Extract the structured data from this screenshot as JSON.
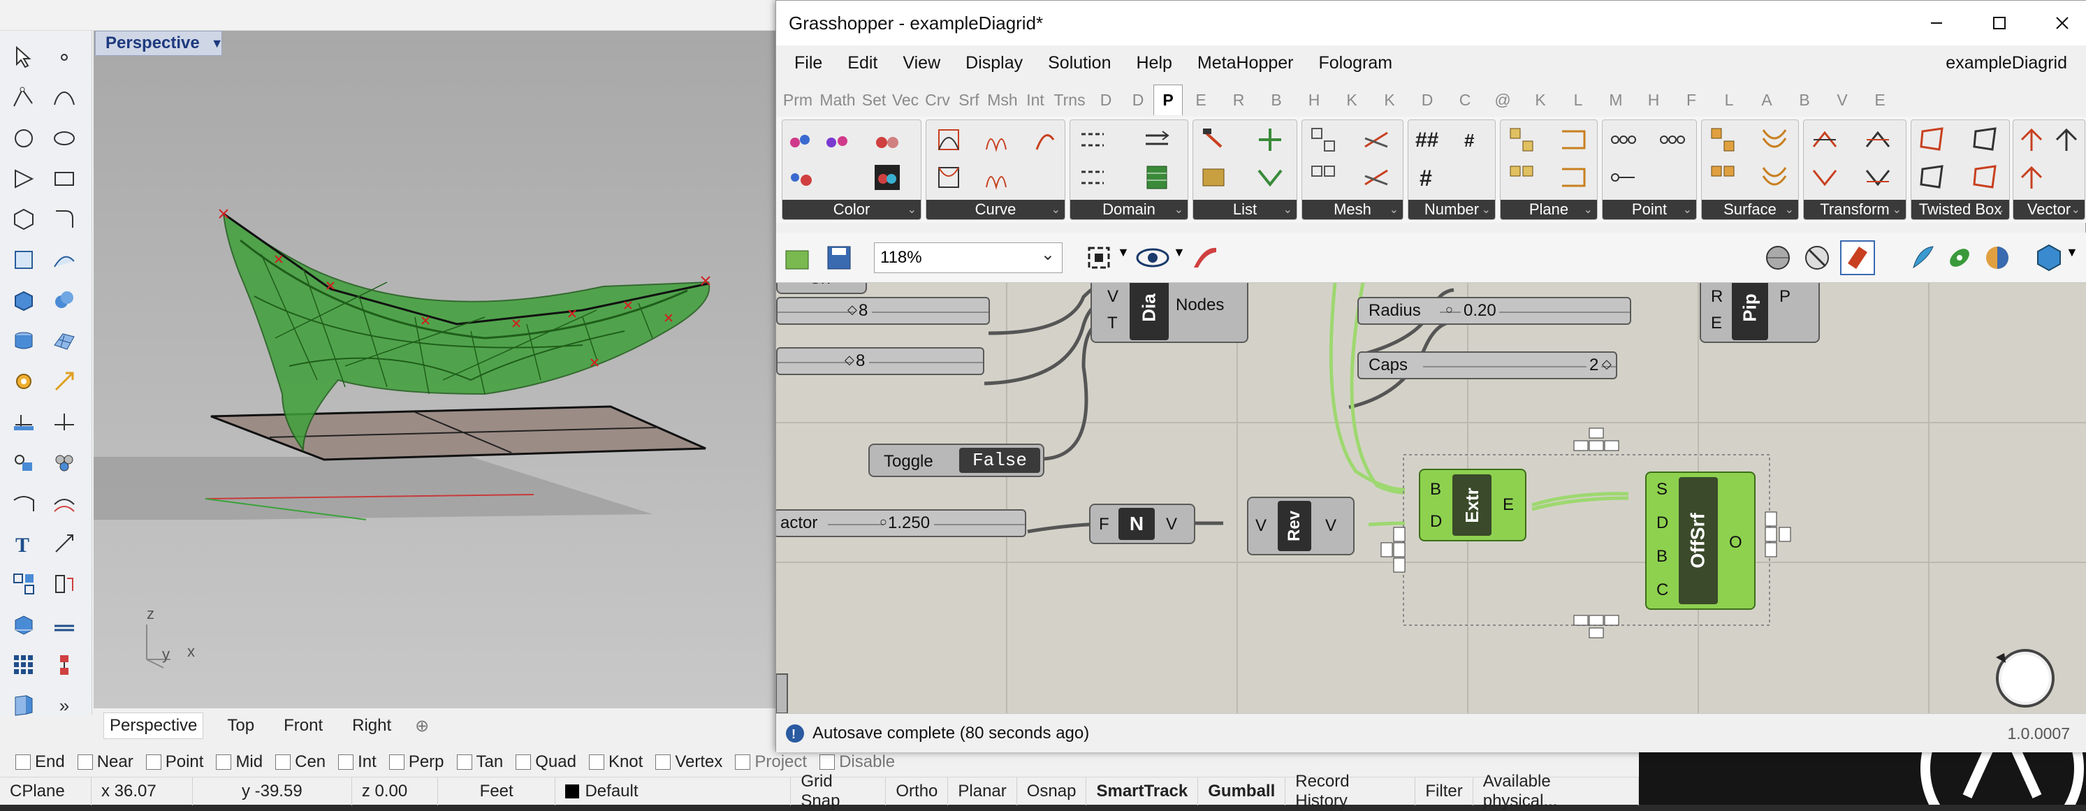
{
  "rhino": {
    "viewport_tab": "Perspective",
    "view_tabs": [
      "Perspective",
      "Top",
      "Front",
      "Right"
    ],
    "axis_labels": {
      "z": "z",
      "y": "y",
      "x": "x"
    },
    "osnaps": [
      {
        "label": "End",
        "dim": false
      },
      {
        "label": "Near",
        "dim": false
      },
      {
        "label": "Point",
        "dim": false
      },
      {
        "label": "Mid",
        "dim": false
      },
      {
        "label": "Cen",
        "dim": false
      },
      {
        "label": "Int",
        "dim": false
      },
      {
        "label": "Perp",
        "dim": false
      },
      {
        "label": "Tan",
        "dim": false
      },
      {
        "label": "Quad",
        "dim": false
      },
      {
        "label": "Knot",
        "dim": false
      },
      {
        "label": "Vertex",
        "dim": false
      },
      {
        "label": "Project",
        "dim": true
      },
      {
        "label": "Disable",
        "dim": true
      }
    ],
    "status": {
      "cplane": "CPlane",
      "x": "x 36.07",
      "y": "y -39.59",
      "z": "z 0.00",
      "units": "Feet",
      "layer": "Default",
      "buttons": [
        {
          "label": "Grid Snap",
          "bold": false
        },
        {
          "label": "Ortho",
          "bold": false
        },
        {
          "label": "Planar",
          "bold": false
        },
        {
          "label": "Osnap",
          "bold": false
        },
        {
          "label": "SmartTrack",
          "bold": true
        },
        {
          "label": "Gumball",
          "bold": true
        },
        {
          "label": "Record History",
          "bold": false
        },
        {
          "label": "Filter",
          "bold": false
        },
        {
          "label": "Available physical...",
          "bold": false
        }
      ]
    }
  },
  "gh": {
    "title": "Grasshopper - exampleDiagrid*",
    "doc_name": "exampleDiagrid",
    "menu": [
      "File",
      "Edit",
      "View",
      "Display",
      "Solution",
      "Help",
      "MetaHopper",
      "Fologram"
    ],
    "tabs": [
      "Prm",
      "Math",
      "Set",
      "Vec",
      "Crv",
      "Srf",
      "Msh",
      "Int",
      "Trns",
      "D",
      "D",
      "P",
      "E",
      "R",
      "B",
      "H",
      "K",
      "K",
      "D",
      "C",
      "@",
      "K",
      "L",
      "M",
      "H",
      "F",
      "L",
      "A",
      "B",
      "V",
      "E"
    ],
    "active_tab": "P",
    "ribbon_groups": [
      "Color",
      "Curve",
      "Domain",
      "List",
      "Mesh",
      "Number",
      "Plane",
      "Point",
      "Surface",
      "Transform",
      "Twisted Box",
      "Vector"
    ],
    "zoom": "118%",
    "status": "Autosave complete (80 seconds ago)",
    "version": "1.0.0007",
    "canvas": {
      "node_diag": {
        "label": "Dia",
        "inputs": [
          "V",
          "T"
        ],
        "output": "Nodes"
      },
      "slider_1": {
        "value": "8"
      },
      "slider_2": {
        "value": "8"
      },
      "radius": {
        "label": "Radius",
        "value": "0.20"
      },
      "caps": {
        "label": "Caps",
        "value": "2"
      },
      "toggle": {
        "label": "Toggle",
        "value": "False"
      },
      "factor": {
        "label": "actor",
        "value": "1.250"
      },
      "neg": {
        "input": "F",
        "label": "N",
        "output": "V"
      },
      "rev": {
        "input": "V",
        "label": "Rev",
        "output": "V"
      },
      "extr": {
        "inputs": [
          "B",
          "D"
        ],
        "label": "Extr",
        "output": "E"
      },
      "offsrf": {
        "inputs": [
          "S",
          "D",
          "B",
          "C"
        ],
        "label": "OffSrf",
        "output": "O"
      },
      "pipe": {
        "inputs": [
          "R",
          "E"
        ],
        "label": "Pip",
        "output": "P"
      },
      "partial": "Srf"
    }
  },
  "colors": {
    "brand_green": "#8ed14f",
    "node_dark": "#2e2e2e",
    "canvas": "#d4d2c8",
    "viewport_title": "#1e3a7e"
  }
}
